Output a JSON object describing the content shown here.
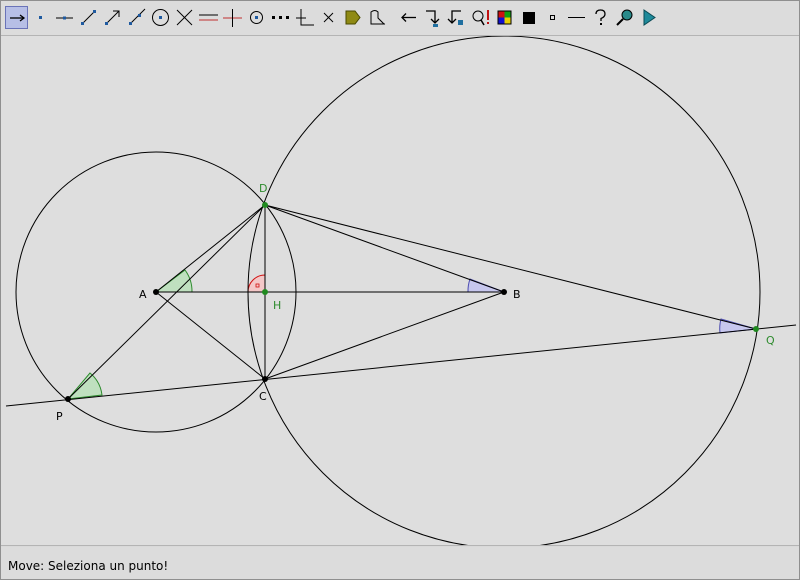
{
  "toolbar": {
    "tools": [
      {
        "name": "move-tool",
        "icon": "arrow-icon"
      },
      {
        "name": "point-tool",
        "icon": "point-icon"
      },
      {
        "name": "line-tool",
        "icon": "line-icon"
      },
      {
        "name": "segment-tool",
        "icon": "segment-icon"
      },
      {
        "name": "vector-tool",
        "icon": "vector-icon"
      },
      {
        "name": "ray-tool",
        "icon": "ray-icon"
      },
      {
        "name": "circle-tool",
        "icon": "circle-icon"
      },
      {
        "name": "intersect-tool",
        "icon": "intersect-icon"
      },
      {
        "name": "parallel-tool",
        "icon": "parallel-icon"
      },
      {
        "name": "perpendicular-tool",
        "icon": "perpendicular-icon"
      },
      {
        "name": "midpoint-tool",
        "icon": "midpoint-icon"
      },
      {
        "name": "segment-by-points-tool",
        "icon": "dotted-line-icon"
      },
      {
        "name": "angle-tool",
        "icon": "angle-icon"
      },
      {
        "name": "delete-tool",
        "icon": "cross-icon"
      },
      {
        "name": "label-tool",
        "icon": "label-tag-icon"
      },
      {
        "name": "measure-tool",
        "icon": "measure-icon"
      },
      {
        "name": "undo-tool",
        "icon": "left-arrow-icon"
      },
      {
        "name": "redo-tool",
        "icon": "redo-arrow-icon"
      },
      {
        "name": "trace-tool",
        "icon": "trace-icon"
      },
      {
        "name": "error-tool",
        "icon": "magnifier-alert-icon"
      },
      {
        "name": "color-tool",
        "icon": "color-palette-icon"
      },
      {
        "name": "fill-tool",
        "icon": "filled-square-icon"
      },
      {
        "name": "point-style-tool",
        "icon": "small-square-icon"
      },
      {
        "name": "line-style-tool",
        "icon": "dash-icon"
      },
      {
        "name": "help-tool",
        "icon": "question-icon"
      },
      {
        "name": "zoom-tool",
        "icon": "magnifier-icon"
      },
      {
        "name": "play-tool",
        "icon": "play-icon"
      }
    ]
  },
  "labels": {
    "A": "A",
    "B": "B",
    "C": "C",
    "D": "D",
    "H": "H",
    "P": "P",
    "Q": "Q"
  },
  "colors": {
    "point_black": "#000000",
    "point_green": "#1f8a1f",
    "label_green": "#2e8b2e",
    "angle_green": "#2e8b2e",
    "angle_blue": "#4a4ab0",
    "angle_red": "#d01010"
  },
  "status": {
    "message": "Move: Seleziona un punto!"
  }
}
